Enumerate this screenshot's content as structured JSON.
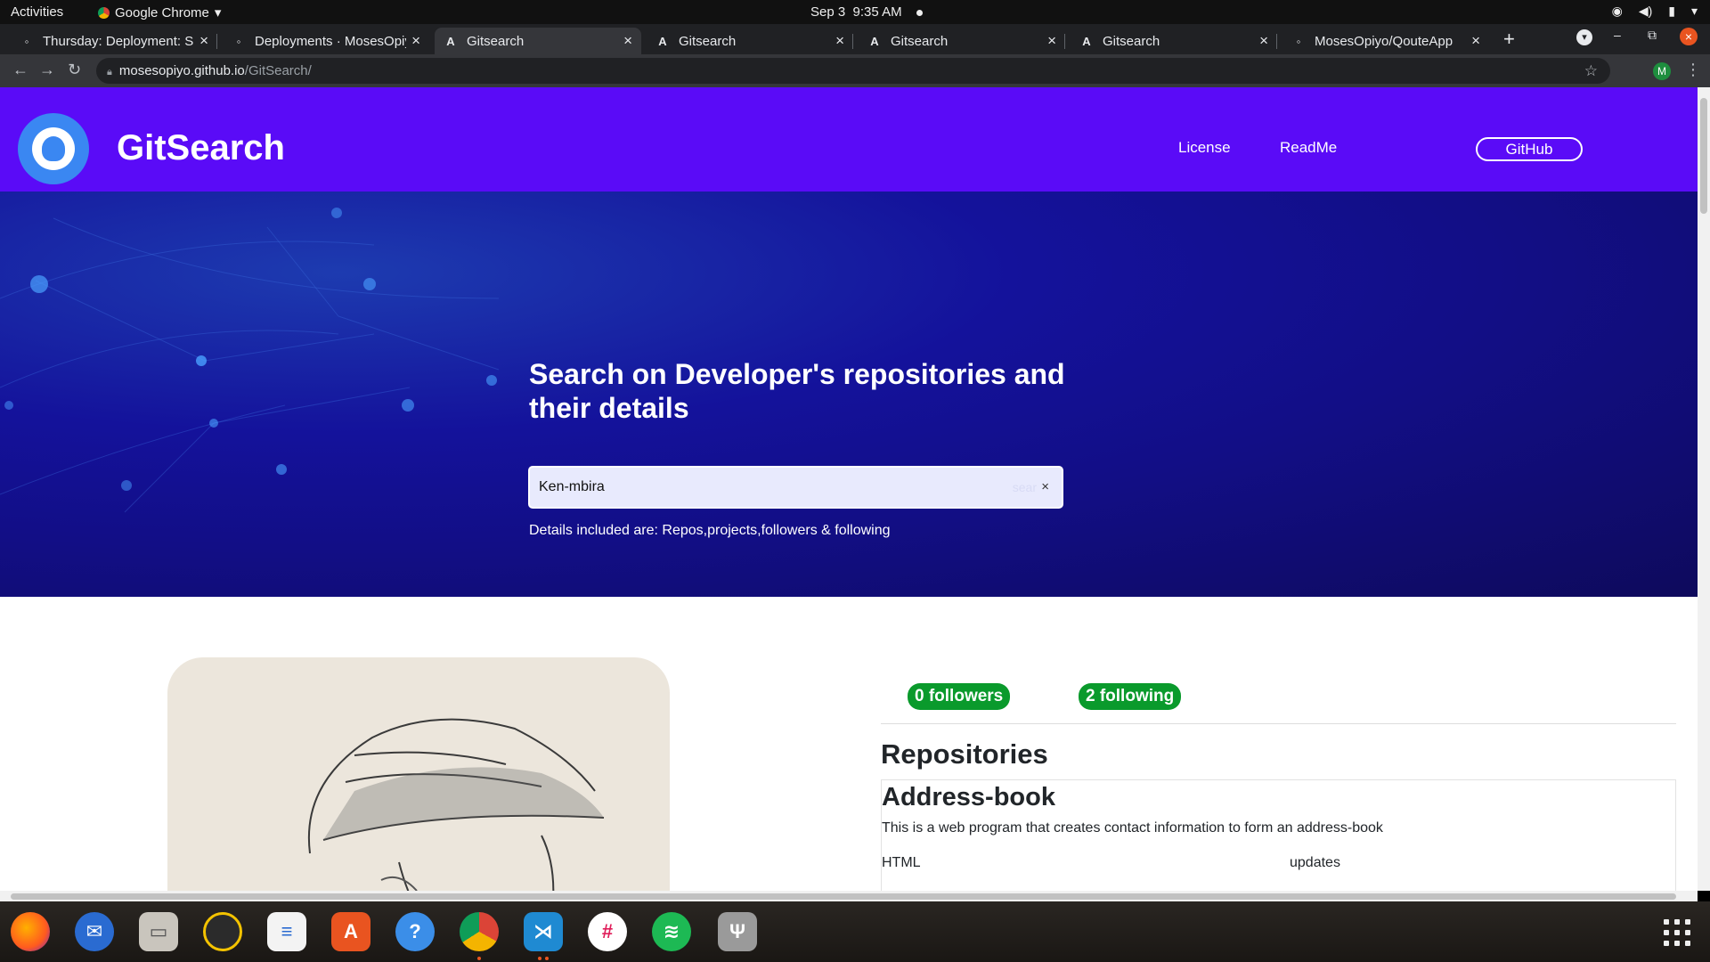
{
  "topbar": {
    "activities": "Activities",
    "app_name": "Google Chrome",
    "date": "Sep 3",
    "time": "9:35 AM"
  },
  "tabs": [
    {
      "title": "Thursday: Deployment: Sl",
      "favicon": "page-icon",
      "active": false
    },
    {
      "title": "Deployments · MosesOpiy",
      "favicon": "github-icon",
      "active": false
    },
    {
      "title": "Gitsearch",
      "favicon": "angular-icon",
      "active": true
    },
    {
      "title": "Gitsearch",
      "favicon": "angular-icon",
      "active": false
    },
    {
      "title": "Gitsearch",
      "favicon": "angular-icon",
      "active": false
    },
    {
      "title": "Gitsearch",
      "favicon": "angular-icon",
      "active": false
    },
    {
      "title": "MosesOpiyo/QouteApp",
      "favicon": "github-icon",
      "active": false
    }
  ],
  "omnibox": {
    "host": "mosesopiyo.github.io",
    "path": "/GitSearch/"
  },
  "profile_initial": "M",
  "site": {
    "brand": "GitSearch",
    "nav": {
      "license": "License",
      "readme": "ReadMe",
      "github": "GitHub"
    },
    "hero": {
      "title": "Search on Developer's repositories and their details",
      "search_value": "Ken-mbira",
      "search_button": "sear",
      "note": "Details included are: Repos,projects,followers & following"
    },
    "profile": {
      "followers": "0 followers",
      "following": "2 following"
    },
    "repos_heading": "Repositories",
    "repos": [
      {
        "name": "Address-book",
        "description": "This is a web program that creates contact information to form an address-book",
        "language": "HTML",
        "updated": "updates"
      }
    ]
  },
  "dock": [
    "firefox-icon",
    "thunderbird-icon",
    "files-icon",
    "rhythmbox-icon",
    "writer-icon",
    "software-icon",
    "help-icon",
    "chrome-icon",
    "vscode-icon",
    "slack-icon",
    "spotify-icon",
    "usb-icon"
  ],
  "colors": {
    "site_nav": "#5a0bf7",
    "badge_green": "#0a9a2c",
    "hero_dark": "#120e86"
  }
}
